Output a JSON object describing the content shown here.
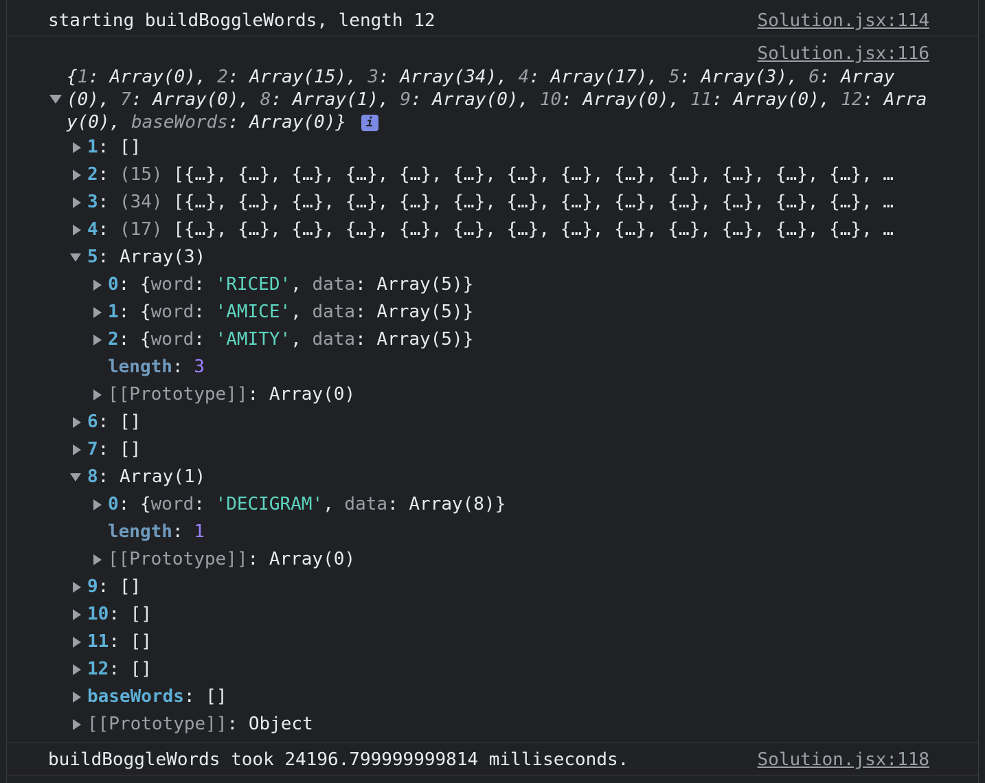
{
  "log_start": {
    "message": "starting buildBoggleWords, length 12",
    "source": "Solution.jsx:114"
  },
  "log_obj": {
    "source": "Solution.jsx:116",
    "summary": [
      {
        "k": "1",
        "v": "Array(0)"
      },
      {
        "k": "2",
        "v": "Array(15)"
      },
      {
        "k": "3",
        "v": "Array(34)"
      },
      {
        "k": "4",
        "v": "Array(17)"
      },
      {
        "k": "5",
        "v": "Array(3)"
      },
      {
        "k": "6",
        "v": "Array(0)"
      },
      {
        "k": "7",
        "v": "Array(0)"
      },
      {
        "k": "8",
        "v": "Array(1)"
      },
      {
        "k": "9",
        "v": "Array(0)"
      },
      {
        "k": "10",
        "v": "Array(0)"
      },
      {
        "k": "11",
        "v": "Array(0)"
      },
      {
        "k": "12",
        "v": "Array(0)"
      },
      {
        "k": "baseWords",
        "v": "Array(0)"
      }
    ],
    "info_badge": "i",
    "tree": {
      "k1": "1",
      "v1": "[]",
      "k2": "2",
      "c2": "(15)",
      "v2": "[{…}, {…}, {…}, {…}, {…}, {…}, {…}, {…}, {…}, {…}, {…}, {…}, {…}, …",
      "k3": "3",
      "c3": "(34)",
      "v3": "[{…}, {…}, {…}, {…}, {…}, {…}, {…}, {…}, {…}, {…}, {…}, {…}, {…}, …",
      "k4": "4",
      "c4": "(17)",
      "v4": "[{…}, {…}, {…}, {…}, {…}, {…}, {…}, {…}, {…}, {…}, {…}, {…}, {…}, …",
      "k5": "5",
      "v5": "Array(3)",
      "five": {
        "items": [
          {
            "idx": "0",
            "word": "'RICED'",
            "data": "Array(5)}"
          },
          {
            "idx": "1",
            "word": "'AMICE'",
            "data": "Array(5)}"
          },
          {
            "idx": "2",
            "word": "'AMITY'",
            "data": "Array(5)}"
          }
        ],
        "length_key": "length",
        "length_val": "3",
        "proto_key": "[[Prototype]]",
        "proto_val": "Array(0)"
      },
      "k6": "6",
      "v6": "[]",
      "k7": "7",
      "v7": "[]",
      "k8": "8",
      "v8": "Array(1)",
      "eight": {
        "idx": "0",
        "word": "'DECIGRAM'",
        "data": "Array(8)}",
        "length_key": "length",
        "length_val": "1",
        "proto_key": "[[Prototype]]",
        "proto_val": "Array(0)"
      },
      "k9": "9",
      "v9": "[]",
      "k10": "10",
      "v10": "[]",
      "k11": "11",
      "v11": "[]",
      "k12": "12",
      "v12": "[]",
      "kbase": "baseWords",
      "vbase": "[]",
      "kproto": "[[Prototype]]",
      "vproto": "Object"
    }
  },
  "log_end": {
    "message": "buildBoggleWords took 24196.799999999814 milliseconds.",
    "source": "Solution.jsx:118"
  }
}
